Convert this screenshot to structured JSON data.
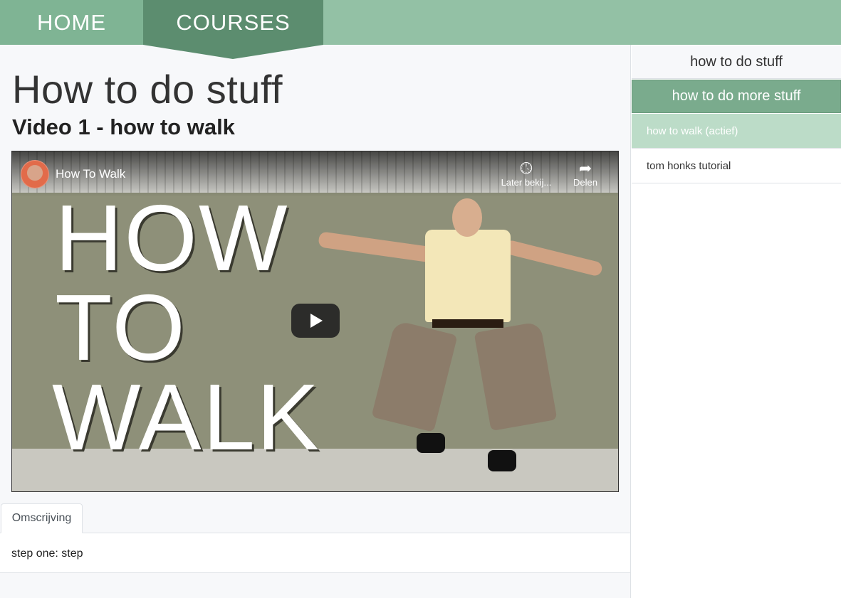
{
  "nav": {
    "home": "HOME",
    "courses": "COURSES"
  },
  "main": {
    "title": "How to do stuff",
    "video_title": "Video 1 - how to walk",
    "video": {
      "yt_title": "How To Walk",
      "later_label": "Later bekij...",
      "share_label": "Delen",
      "overlay_line1": "HOW",
      "overlay_line2": "TO",
      "overlay_line3": "WALK"
    },
    "tab_label": "Omscrijving",
    "description": "step one: step"
  },
  "sidebar": {
    "courses": [
      "how to do stuff",
      "how to do more stuff"
    ],
    "items": [
      "how to walk (actief)",
      "tom honks tutorial"
    ]
  },
  "colors": {
    "nav_bg": "#93c1a5",
    "nav_active": "#5c8d6f",
    "sidebar_active_course": "#7aab8d",
    "sidebar_active_item": "#bcdcc8"
  },
  "icons": {
    "later": "clock-icon",
    "share": "share-arrow-icon",
    "play": "play-icon"
  }
}
